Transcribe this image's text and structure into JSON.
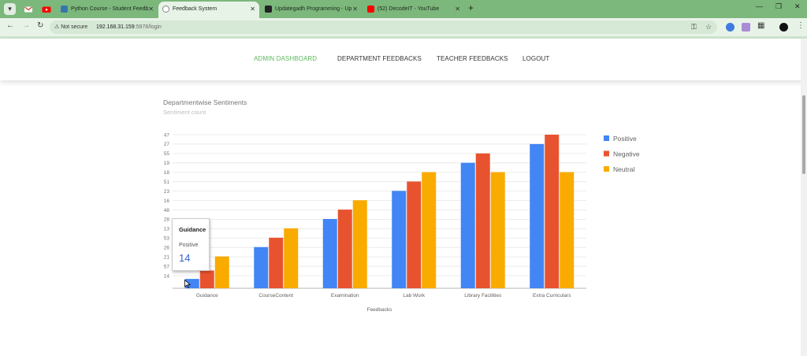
{
  "browser": {
    "tabs": [
      {
        "title": "",
        "favicon_color": "#d44638",
        "icon": "gmail-icon"
      },
      {
        "title": "",
        "favicon_color": "#ff0000",
        "icon": "youtube-icon"
      },
      {
        "title": "Python Course - Student Feedb",
        "favicon_color": "#3776ab",
        "icon": "python-icon"
      },
      {
        "title": "Feedback System",
        "favicon_color": "#888888",
        "icon": "globe-icon"
      },
      {
        "title": "Updategadh Programming - Up",
        "favicon_color": "#222222",
        "icon": "site-icon"
      },
      {
        "title": "(52) DecodeIT - YouTube",
        "favicon_color": "#ff0000",
        "icon": "youtube-icon"
      }
    ],
    "new_tab_label": "+",
    "security_label": "Not secure",
    "url_host": "192.168.31.159",
    "url_path": ":5978/login"
  },
  "nav": {
    "admin_dashboard": "ADMIN DASHBOARD",
    "department_feedbacks": "DEPARTMENT FEEDBACKS",
    "teacher_feedbacks": "TEACHER FEEDBACKS",
    "logout": "LOGOUT"
  },
  "colors": {
    "accent": "#5cb85c",
    "positive": "#4285f4",
    "negative": "#e8532f",
    "neutral": "#f9ab00"
  },
  "chart_data": {
    "type": "bar",
    "title": "Departmentwise Sentiments",
    "subtitle": "Sentiment count",
    "xlabel": "Feedbacks",
    "categories": [
      "Guidance",
      "CourseContent",
      "Examination",
      "Lab Work",
      "Library Facilities",
      "Extra Curriculars"
    ],
    "y_tick_labels": [
      "47",
      "27",
      "55",
      "19",
      "18",
      "51",
      "23",
      "16",
      "48",
      "28",
      "13",
      "53",
      "26",
      "21",
      "57",
      "14"
    ],
    "series": [
      {
        "name": "Positive",
        "color": "#4285f4",
        "values": [
          1,
          4.4,
          7.4,
          10.4,
          13.4,
          15.4
        ]
      },
      {
        "name": "Negative",
        "color": "#e8532f",
        "values": [
          1.9,
          5.4,
          8.4,
          11.4,
          14.4,
          16.4
        ]
      },
      {
        "name": "Neutral",
        "color": "#f9ab00",
        "values": [
          3.4,
          6.4,
          9.4,
          12.4,
          12.4,
          12.4
        ]
      }
    ],
    "ylim": [
      0,
      16.4
    ],
    "grid": true,
    "legend_position": "right"
  },
  "tooltip": {
    "category": "Guidance",
    "series": "Positive",
    "value": "14"
  }
}
